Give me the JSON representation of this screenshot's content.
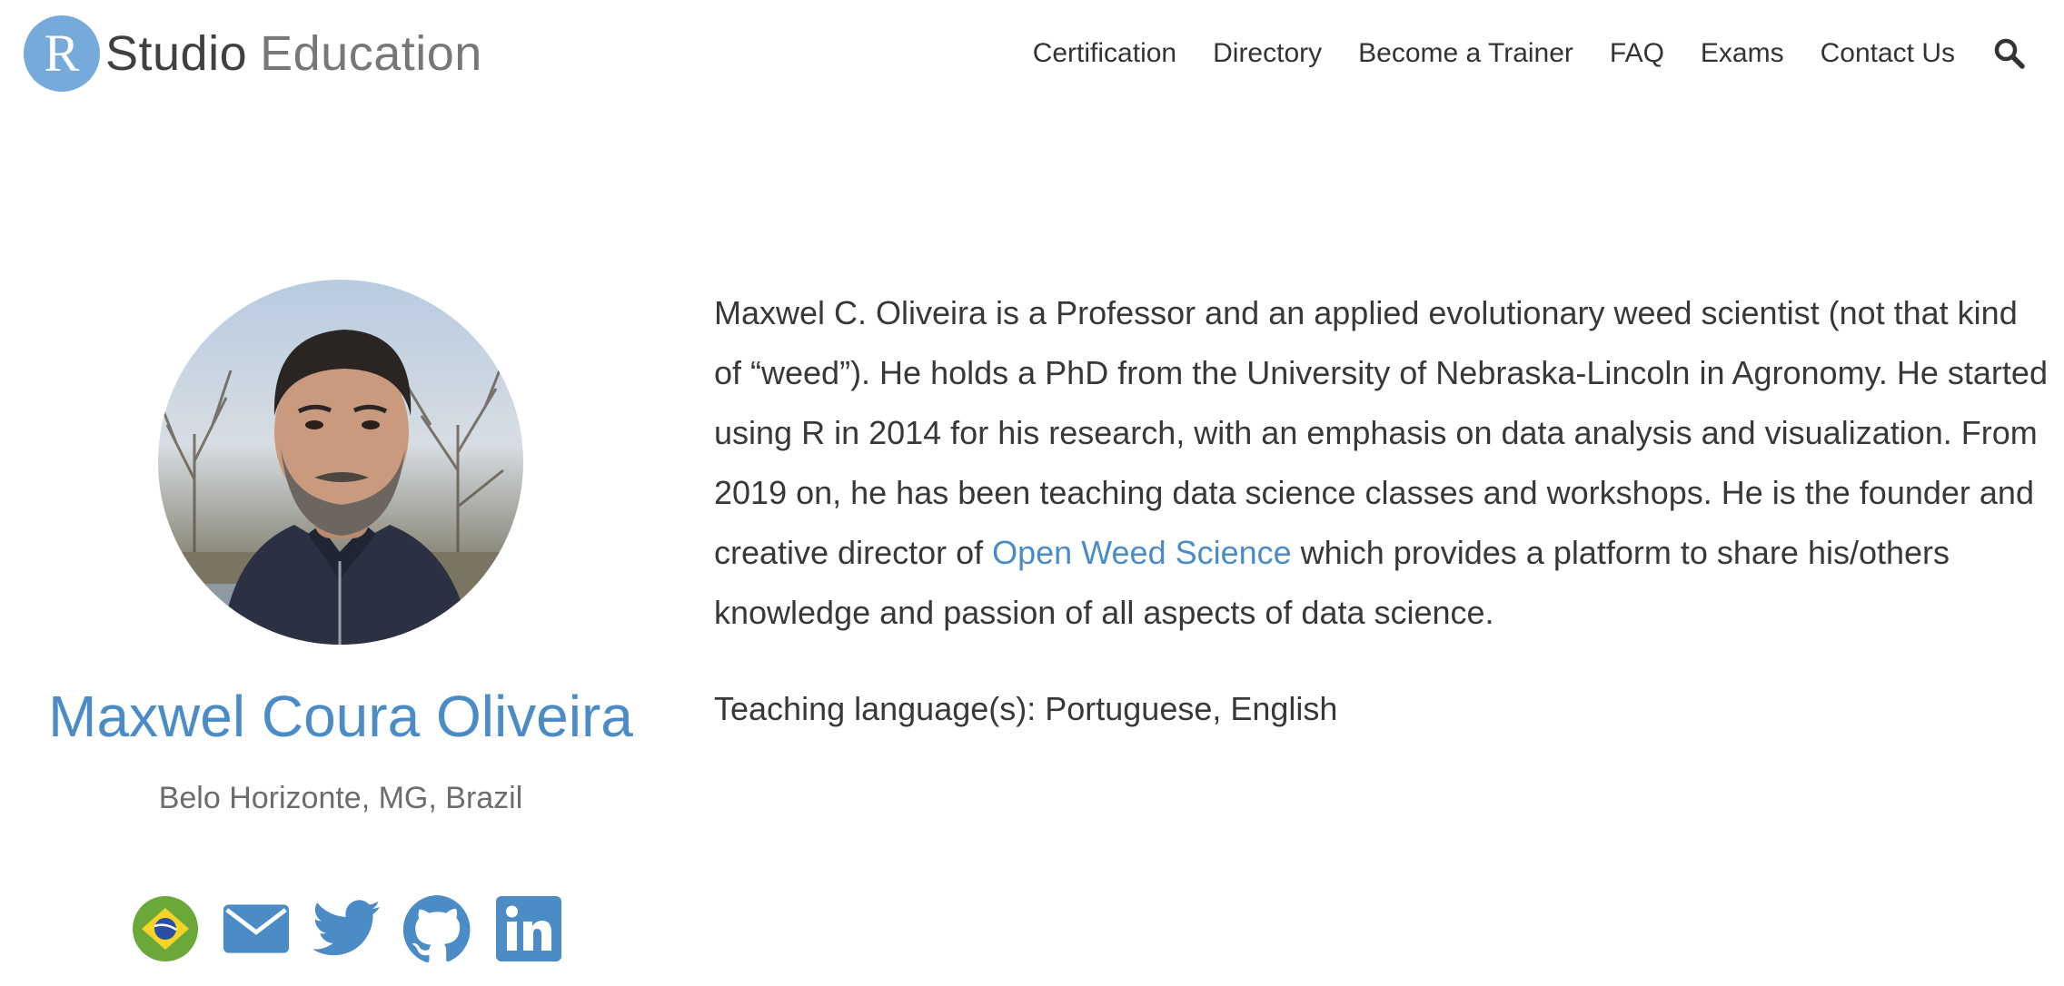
{
  "brand": {
    "letter": "R",
    "studio": "Studio",
    "education": "Education",
    "color": "#75aadb"
  },
  "nav": {
    "items": [
      "Certification",
      "Directory",
      "Become a Trainer",
      "FAQ",
      "Exams",
      "Contact Us"
    ],
    "search_icon": "search-icon"
  },
  "profile": {
    "name": "Maxwel Coura Oliveira",
    "location": "Belo Horizonte, MG, Brazil",
    "name_color": "#4b8cc6",
    "social_icons": [
      "brazil-flag-icon",
      "email-icon",
      "twitter-icon",
      "github-icon",
      "linkedin-icon"
    ]
  },
  "bio": {
    "text_before": "Maxwel C. Oliveira is a Professor and an applied evolutionary weed scientist (not that kind of “weed”). He holds a PhD from the University of Nebraska-Lincoln in Agronomy. He started using R in 2014 for his research, with an emphasis on data analysis and visualization. From 2019 on, he has been teaching data science classes and workshops. He is the founder and creative director of ",
    "link_text": "Open Weed Science",
    "text_after": " which provides a platform to share his/others knowledge and passion of all aspects of data science.",
    "languages": "Teaching language(s): Portuguese, English"
  }
}
